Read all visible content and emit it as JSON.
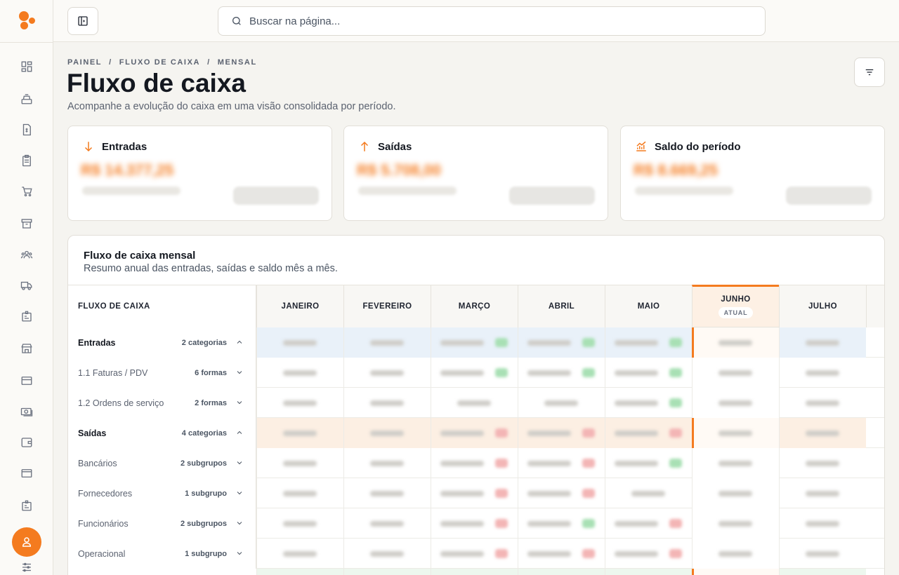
{
  "search": {
    "placeholder": "Buscar na página..."
  },
  "breadcrumb": [
    "PAINEL",
    "/",
    "FLUXO DE CAIXA",
    "/",
    "MENSAL"
  ],
  "page": {
    "title": "Fluxo de caixa",
    "subtitle": "Acompanhe a evolução do caixa em uma visão consolidada por período."
  },
  "cards": [
    {
      "title": "Entradas",
      "icon": "arrow-down-icon",
      "value": "R$ 14.377,25"
    },
    {
      "title": "Saídas",
      "icon": "arrow-up-icon",
      "value": "R$ 5.708,00"
    },
    {
      "title": "Saldo do período",
      "icon": "trend-chart-icon",
      "value": "R$ 8.669,25"
    }
  ],
  "table": {
    "title": "Fluxo de caixa mensal",
    "subtitle": "Resumo anual das entradas, saídas e saldo mês a mês.",
    "first_header": "FLUXO DE CAIXA",
    "months": [
      "JANEIRO",
      "FEVEREIRO",
      "MARÇO",
      "ABRIL",
      "MAIO",
      "JUNHO",
      "JULHO"
    ],
    "current_month": "JUNHO",
    "current_badge": "ATUAL",
    "rows": [
      {
        "label": "Entradas",
        "meta": "2 categorias",
        "kind": "group",
        "expanded": true
      },
      {
        "label": "1.1 Faturas / PDV",
        "meta": "6 formas",
        "kind": "sub"
      },
      {
        "label": "1.2 Ordens de serviço",
        "meta": "2 formas",
        "kind": "sub"
      },
      {
        "label": "Saídas",
        "meta": "4 categorias",
        "kind": "group",
        "expanded": true
      },
      {
        "label": "Bancários",
        "meta": "2 subgrupos",
        "kind": "sub"
      },
      {
        "label": "Fornecedores",
        "meta": "1 subgrupo",
        "kind": "sub"
      },
      {
        "label": "Funcionários",
        "meta": "2 subgrupos",
        "kind": "sub"
      },
      {
        "label": "Operacional",
        "meta": "1 subgrupo",
        "kind": "sub"
      }
    ]
  },
  "colors": {
    "accent": "#f47b1f",
    "positive": "#a8e0b4",
    "negative": "#f3b5b5"
  },
  "nav_icons": [
    "dashboard-icon",
    "cash-register-icon",
    "invoice-icon",
    "clipboard-icon",
    "cart-icon",
    "archive-icon",
    "team-icon",
    "truck-icon",
    "badge-icon",
    "store-icon",
    "card-icon",
    "money-icon",
    "wallet-icon",
    "card-alt-icon",
    "id-card-icon",
    "sliders-icon"
  ]
}
